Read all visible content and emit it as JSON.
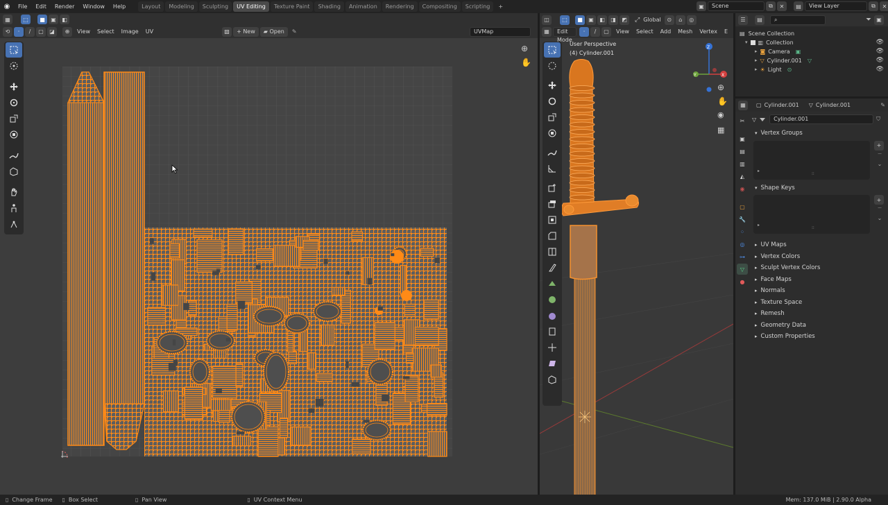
{
  "top_menu": {
    "items": [
      "File",
      "Edit",
      "Render",
      "Window",
      "Help"
    ]
  },
  "workspace_tabs": [
    "Layout",
    "Modeling",
    "Sculpting",
    "UV Editing",
    "Texture Paint",
    "Shading",
    "Animation",
    "Rendering",
    "Compositing",
    "Scripting"
  ],
  "active_tab": "UV Editing",
  "scene_field": "Scene",
  "view_layer_field": "View Layer",
  "uv_editor": {
    "menus": [
      "View",
      "Select",
      "Image",
      "UV"
    ],
    "new_label": "New",
    "open_label": "Open",
    "uvmap_name": "UVMap"
  },
  "viewport": {
    "mode": "Edit Mode",
    "transform": "Global",
    "menus": [
      "View",
      "Select",
      "Add",
      "Mesh",
      "Vertex",
      "E"
    ],
    "overlay_title": "User Perspective",
    "overlay_object": "(4) Cylinder.001",
    "gizmo": {
      "x": "X",
      "y": "Y",
      "z": "Z"
    }
  },
  "outliner": {
    "root": "Scene Collection",
    "collection": "Collection",
    "items": [
      "Camera",
      "Cylinder.001",
      "Light"
    ],
    "search_placeholder": ""
  },
  "properties": {
    "breadcrumb_object": "Cylinder.001",
    "breadcrumb_mesh": "Cylinder.001",
    "mesh_name": "Cylinder.001",
    "vertex_groups": "Vertex Groups",
    "shape_keys": "Shape Keys",
    "sections": [
      "UV Maps",
      "Vertex Colors",
      "Sculpt Vertex Colors",
      "Face Maps",
      "Normals",
      "Texture Space",
      "Remesh",
      "Geometry Data",
      "Custom Properties"
    ]
  },
  "status_bar": {
    "change_frame": "Change Frame",
    "box_select": "Box Select",
    "pan_view": "Pan View",
    "uv_context_menu": "UV Context Menu",
    "memory": "Mem: 137.0 MiB | 2.90.0 Alpha"
  },
  "colors": {
    "accent": "#4772b3",
    "uv_orange": "#ff8a16",
    "mesh_orange": "#f5912e",
    "background": "#3d3d3d"
  }
}
